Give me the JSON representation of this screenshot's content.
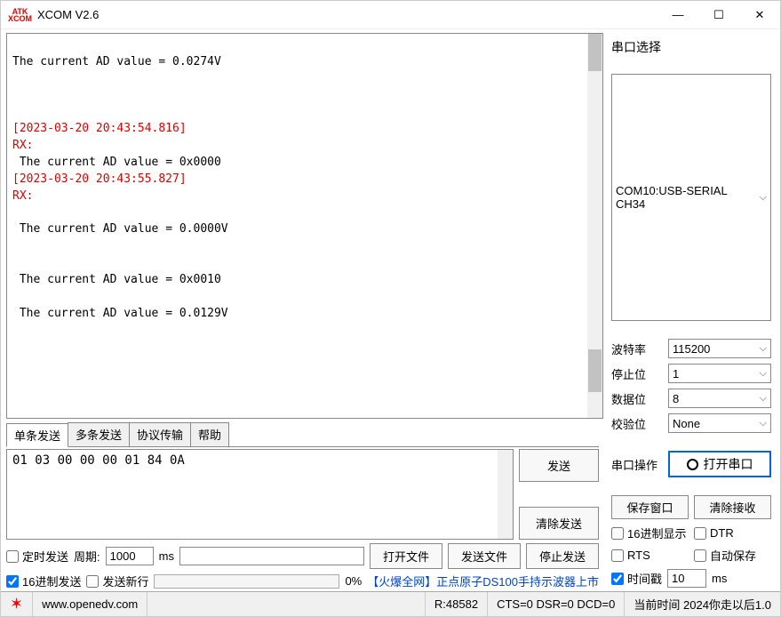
{
  "window": {
    "title": "XCOM V2.6",
    "logo1": "ATK",
    "logo2": "XCOM"
  },
  "rx": {
    "l1": "The current AD value = 0.0274V",
    "ts1": "[2023-03-20 20:43:54.816]",
    "rx1": "RX:",
    "l2": " The current AD value = 0x0000",
    "ts2": "[2023-03-20 20:43:55.827]",
    "rx2": "RX:",
    "l3": " The current AD value = 0.0000V",
    "l4": " The current AD value = 0x0010",
    "l5": " The current AD value = 0.0129V"
  },
  "tabs": {
    "t1": "单条发送",
    "t2": "多条发送",
    "t3": "协议传输",
    "t4": "帮助"
  },
  "tx": {
    "content": "01 03 00 00 00 01 84 0A"
  },
  "buttons": {
    "send": "发送",
    "clearsend": "清除发送",
    "openfile": "打开文件",
    "sendfile": "发送文件",
    "stopsend": "停止发送",
    "savewin": "保存窗口",
    "clearrx": "清除接收"
  },
  "opts": {
    "timed": "定时发送",
    "period_label": "周期:",
    "period": "1000",
    "ms": "ms",
    "hexsend": "16进制发送",
    "newline": "发送新行",
    "pct": "0%"
  },
  "link": "【火爆全网】正点原子DS100手持示波器上市",
  "right": {
    "title": "串口选择",
    "port": "COM10:USB-SERIAL CH34",
    "baud_l": "波特率",
    "baud": "115200",
    "stop_l": "停止位",
    "stop": "1",
    "data_l": "数据位",
    "data": "8",
    "parity_l": "校验位",
    "parity": "None",
    "op_l": "串口操作",
    "open": "打开串口",
    "hexdisp": "16进制显示",
    "dtr": "DTR",
    "rts": "RTS",
    "autosave": "自动保存",
    "timestamp": "时间戳",
    "ts_val": "10",
    "ts_ms": "ms"
  },
  "status": {
    "url": "www.openedv.com",
    "r": "R:48582",
    "cts": "CTS=0 DSR=0 DCD=0",
    "tail": "当前时间 2024你走以后1.0"
  }
}
